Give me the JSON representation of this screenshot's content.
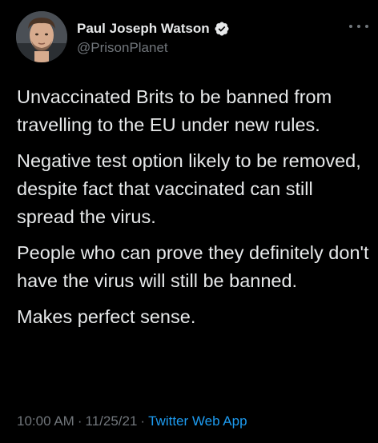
{
  "tweet": {
    "author": {
      "display_name": "Paul Joseph Watson",
      "handle": "@PrisonPlanet",
      "verified": true
    },
    "paragraphs": [
      "Unvaccinated Brits to be banned from travelling to the EU under new rules.",
      "Negative test option likely to be removed, despite fact that vaccinated can still spread the virus.",
      "People who can prove they definitely don't have the virus will still be banned.",
      "Makes perfect sense."
    ],
    "time": "10:00 AM",
    "date": "11/25/21",
    "source": "Twitter Web App",
    "separator": "·"
  },
  "icons": {
    "verified": "verified-badge-icon",
    "more": "more-horizontal-icon"
  },
  "colors": {
    "background": "#000000",
    "text_primary": "#e7e9ea",
    "text_secondary": "#71767b",
    "accent": "#1d9bf0"
  }
}
